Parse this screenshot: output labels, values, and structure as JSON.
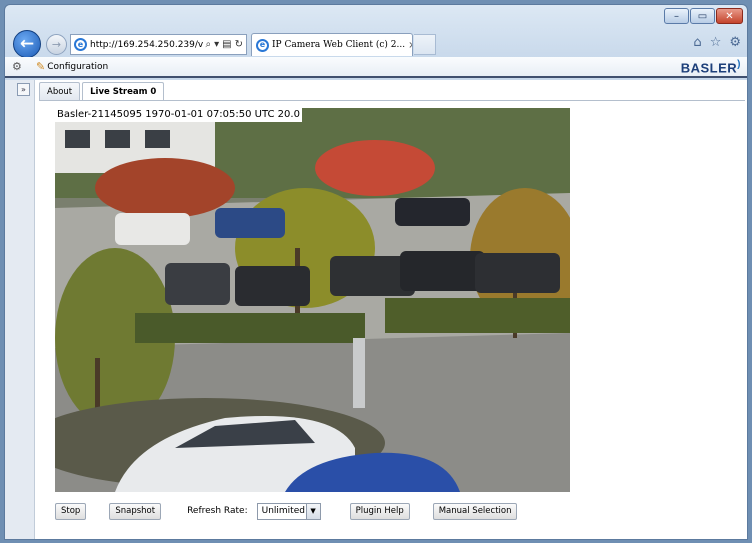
{
  "browser": {
    "url": "http://169.254.250.239/v",
    "tab_title": "IP Camera Web Client (c) 2...",
    "tab_close": "×"
  },
  "window_controls": {
    "minimize": "–",
    "maximize": "▭",
    "close": "✕"
  },
  "command_bar": {
    "configuration_label": "Configuration",
    "logo_text": "BASLER"
  },
  "page_tabs": [
    {
      "label": "About",
      "active": false
    },
    {
      "label": "Live Stream 0",
      "active": true
    }
  ],
  "video": {
    "overlay_text": "Basler-21145095 1970-01-01 07:05:50 UTC  20.0"
  },
  "controls": {
    "stop_label": "Stop",
    "snapshot_label": "Snapshot",
    "refresh_rate_label": "Refresh Rate:",
    "refresh_rate_value": "Unlimited",
    "plugin_help_label": "Plugin Help",
    "manual_selection_label": "Manual Selection"
  },
  "icons": {
    "back": "back-arrow-icon",
    "forward": "forward-arrow-icon",
    "home": "home-icon",
    "favorites": "star-icon",
    "tools": "gear-icon"
  },
  "colors": {
    "accent": "#1c5bb5",
    "brand": "#1d3f7a",
    "close_button": "#c4442c"
  }
}
